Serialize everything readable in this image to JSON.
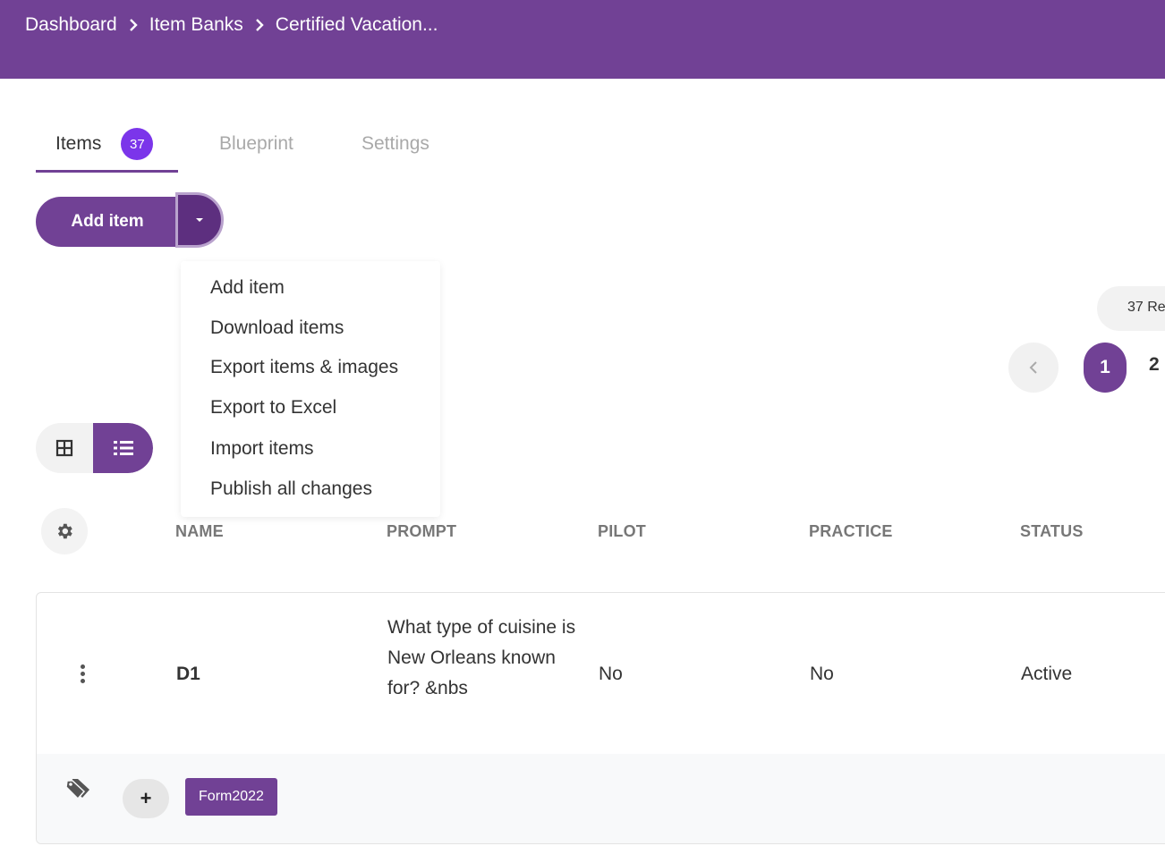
{
  "breadcrumb": {
    "items": [
      "Dashboard",
      "Item Banks",
      "Certified Vacation..."
    ]
  },
  "tabs": [
    {
      "label": "Items",
      "badge": "37",
      "active": true
    },
    {
      "label": "Blueprint",
      "active": false
    },
    {
      "label": "Settings",
      "active": false
    }
  ],
  "actions": {
    "add_item_label": "Add item",
    "menu_items": [
      "Add item",
      "Download items",
      "Export items & images",
      "Export to Excel",
      "Import items",
      "Publish all changes"
    ]
  },
  "records": {
    "label": "37 Re"
  },
  "pagination": {
    "current": "1",
    "next": "2"
  },
  "view_toggle": {
    "active": "list",
    "icons": [
      "grid-icon",
      "list-icon"
    ]
  },
  "table": {
    "columns": [
      "NAME",
      "PROMPT",
      "PILOT",
      "PRACTICE",
      "STATUS"
    ],
    "rows": [
      {
        "name": "D1",
        "prompt": "What type of cuisine is New Orleans known for? &nbs",
        "pilot": "No",
        "practice": "No",
        "status": "Active",
        "tag_add": "+",
        "tags": [
          "Form2022"
        ]
      }
    ]
  },
  "colors": {
    "brand_purple": "#714195",
    "badge_purple": "#7b35ea",
    "header_text": "#ffffff",
    "muted_text": "#a9a9a9"
  }
}
